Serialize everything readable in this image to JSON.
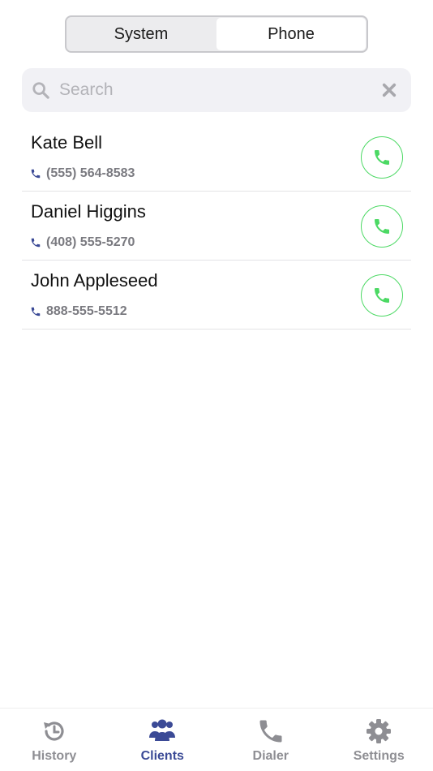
{
  "segment": {
    "options": [
      {
        "label": "System",
        "active": false
      },
      {
        "label": "Phone",
        "active": true
      }
    ]
  },
  "search": {
    "placeholder": "Search",
    "value": ""
  },
  "contacts": [
    {
      "name": "Kate Bell",
      "phone": "(555) 564-8583"
    },
    {
      "name": "Daniel Higgins",
      "phone": "(408) 555-5270"
    },
    {
      "name": "John Appleseed",
      "phone": "888-555-5512"
    }
  ],
  "tabbar": {
    "tabs": [
      {
        "label": "History",
        "icon": "history-icon",
        "active": false
      },
      {
        "label": "Clients",
        "icon": "users-icon",
        "active": true
      },
      {
        "label": "Dialer",
        "icon": "phone-icon",
        "active": false
      },
      {
        "label": "Settings",
        "icon": "gear-icon",
        "active": false
      }
    ]
  },
  "colors": {
    "accent": "#3b4a96",
    "call_green": "#4cd964",
    "inactive": "#8e8e93"
  }
}
